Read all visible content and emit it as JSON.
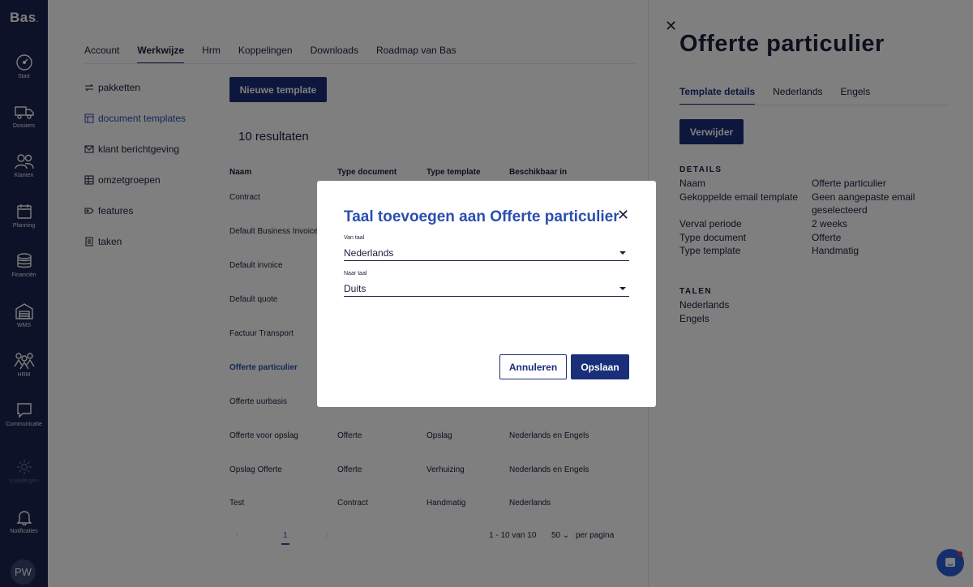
{
  "app": {
    "brand": "Bas"
  },
  "rail": [
    {
      "label": "Start",
      "icon": "dashboard-icon"
    },
    {
      "label": "Dossiers",
      "icon": "truck-icon"
    },
    {
      "label": "Klanten",
      "icon": "users-icon"
    },
    {
      "label": "Planning",
      "icon": "calendar-icon"
    },
    {
      "label": "Financiën",
      "icon": "coins-icon"
    },
    {
      "label": "WMS",
      "icon": "warehouse-icon"
    },
    {
      "label": "HRM",
      "icon": "team-icon"
    },
    {
      "label": "Communicatie",
      "icon": "chat-icon"
    },
    {
      "label": "Instellingen",
      "icon": "gear-icon"
    },
    {
      "label": "Notificaties",
      "icon": "bell-icon"
    }
  ],
  "user": {
    "initials": "PW"
  },
  "topnav": {
    "tabs": [
      {
        "label": "Account"
      },
      {
        "label": "Werkwijze",
        "active": true
      },
      {
        "label": "Hrm"
      },
      {
        "label": "Koppelingen"
      },
      {
        "label": "Downloads"
      },
      {
        "label": "Roadmap van Bas"
      }
    ]
  },
  "sidenav": [
    {
      "label": "pakketten",
      "icon": "swap-icon"
    },
    {
      "label": "document templates",
      "icon": "template-icon",
      "active": true
    },
    {
      "label": "klant berichtgeving",
      "icon": "mail-icon"
    },
    {
      "label": "omzetgroepen",
      "icon": "table-icon"
    },
    {
      "label": "features",
      "icon": "tag-icon"
    },
    {
      "label": "taken",
      "icon": "list-icon"
    }
  ],
  "main": {
    "new_button": "Nieuwe template",
    "results": "10 resultaten",
    "columns": [
      "Naam",
      "Type document",
      "Type template",
      "Beschikbaar in"
    ],
    "rows": [
      [
        "Contract",
        "",
        "",
        ""
      ],
      [
        "Default Business Invoice",
        "",
        "",
        ""
      ],
      [
        "Default invoice",
        "",
        "",
        ""
      ],
      [
        "Default quote",
        "",
        "",
        ""
      ],
      [
        "Factuur Transport",
        "",
        "",
        ""
      ],
      [
        "Offerte particulier",
        "",
        "",
        ""
      ],
      [
        "Offerte uurbasis",
        "",
        "",
        ""
      ],
      [
        "Offerte voor opslag",
        "Offerte",
        "Opslag",
        "Nederlands en Engels"
      ],
      [
        "Opslag Offerte",
        "Offerte",
        "Verhuizing",
        "Nederlands en Engels"
      ],
      [
        "Test",
        "Contract",
        "Handmatig",
        "Nederlands"
      ]
    ],
    "highlight_row": 5,
    "pager": {
      "page": "1",
      "range": "1 - 10 van 10",
      "per_page": "50",
      "per_page_label": "per pagina"
    }
  },
  "panel": {
    "title": "Offerte particulier",
    "tabs": [
      {
        "label": "Template details",
        "active": true
      },
      {
        "label": "Nederlands"
      },
      {
        "label": "Engels"
      }
    ],
    "delete_button": "Verwijder",
    "details_title": "DETAILS",
    "details": [
      {
        "key": "Naam",
        "value": "Offerte particulier"
      },
      {
        "key": "Gekoppelde email template",
        "value": "Geen aangepaste email geselecteerd"
      },
      {
        "key": "Verval periode",
        "value": "2 weeks"
      },
      {
        "key": "Type document",
        "value": "Offerte"
      },
      {
        "key": "Type template",
        "value": "Handmatig"
      }
    ],
    "talen_title": "TALEN",
    "talen": [
      "Nederlands",
      "Engels"
    ]
  },
  "modal": {
    "title": "Taal toevoegen aan Offerte particulier",
    "from_label": "Van taal",
    "from_value": "Nederlands",
    "to_label": "Naar taal",
    "to_value": "Duits",
    "cancel": "Annuleren",
    "save": "Opslaan"
  },
  "colors": {
    "primary": "#1a2f7a",
    "accent": "#2a4fb0",
    "rail": "#1a2550"
  }
}
